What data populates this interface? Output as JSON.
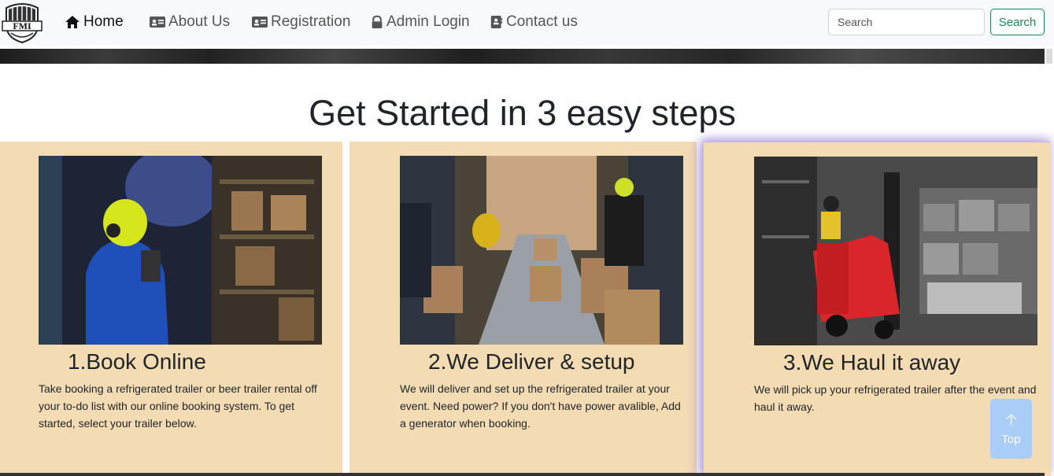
{
  "nav": {
    "logo_text": "FMI",
    "items": [
      {
        "label": "Home",
        "icon": "home-icon"
      },
      {
        "label": "About Us",
        "icon": "id-card-icon"
      },
      {
        "label": "Registration",
        "icon": "id-card-icon"
      },
      {
        "label": "Admin Login",
        "icon": "lock-icon"
      },
      {
        "label": "Contact us",
        "icon": "contact-card-icon"
      }
    ],
    "search_placeholder": "Search",
    "search_button": "Search"
  },
  "section": {
    "title": "Get Started in 3 easy steps"
  },
  "cards": [
    {
      "title": "1.Book Online",
      "text": "Take booking a refrigerated trailer or beer trailer rental off your to-do list with our online booking system. To get started, select your trailer below."
    },
    {
      "title": "2.We Deliver & setup",
      "text": "We will deliver and set up the refrigerated trailer at your event. Need power? If you don't have power avalible, Add a generator when booking."
    },
    {
      "title": "3.We Haul it away",
      "text": "We will pick up your refrigerated trailer after the event and haul it away."
    }
  ],
  "top_button": {
    "label": "Top"
  },
  "colors": {
    "card_bg": "#f3dcb4",
    "navbar_bg": "#f8f9fa",
    "search_button": "#198754",
    "top_button": "#a9cdf7"
  }
}
